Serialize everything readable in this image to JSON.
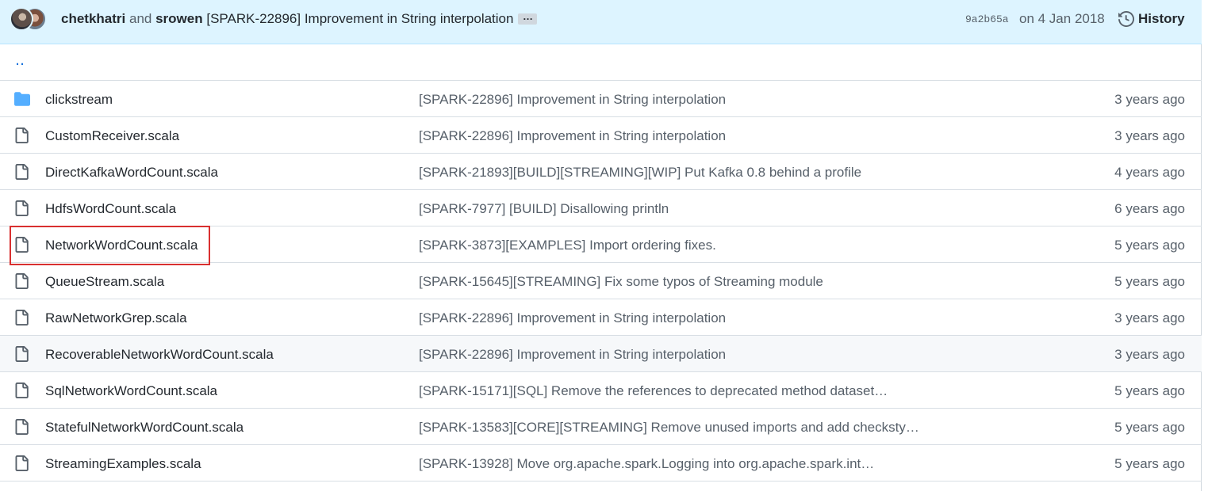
{
  "commit": {
    "authors": [
      "chetkhatri",
      "srowen"
    ],
    "joiner": "and",
    "message": "[SPARK-22896] Improvement in String interpolation",
    "more_label": "…",
    "sha": "9a2b65a",
    "date": "on 4 Jan 2018",
    "history_label": "History"
  },
  "parent_link": "‥",
  "files": [
    {
      "type": "folder",
      "name": "clickstream",
      "message": "[SPARK-22896] Improvement in String interpolation",
      "age": "3 years ago"
    },
    {
      "type": "file",
      "name": "CustomReceiver.scala",
      "message": "[SPARK-22896] Improvement in String interpolation",
      "age": "3 years ago"
    },
    {
      "type": "file",
      "name": "DirectKafkaWordCount.scala",
      "message": "[SPARK-21893][BUILD][STREAMING][WIP] Put Kafka 0.8 behind a profile",
      "age": "4 years ago"
    },
    {
      "type": "file",
      "name": "HdfsWordCount.scala",
      "message": "[SPARK-7977] [BUILD] Disallowing println",
      "age": "6 years ago"
    },
    {
      "type": "file",
      "name": "NetworkWordCount.scala",
      "message": "[SPARK-3873][EXAMPLES] Import ordering fixes.",
      "age": "5 years ago"
    },
    {
      "type": "file",
      "name": "QueueStream.scala",
      "message": "[SPARK-15645][STREAMING] Fix some typos of Streaming module",
      "age": "5 years ago"
    },
    {
      "type": "file",
      "name": "RawNetworkGrep.scala",
      "message": "[SPARK-22896] Improvement in String interpolation",
      "age": "3 years ago"
    },
    {
      "type": "file",
      "name": "RecoverableNetworkWordCount.scala",
      "message": "[SPARK-22896] Improvement in String interpolation",
      "age": "3 years ago"
    },
    {
      "type": "file",
      "name": "SqlNetworkWordCount.scala",
      "message": "[SPARK-15171][SQL] Remove the references to deprecated method dataset…",
      "age": "5 years ago"
    },
    {
      "type": "file",
      "name": "StatefulNetworkWordCount.scala",
      "message": "[SPARK-13583][CORE][STREAMING] Remove unused imports and add checksty…",
      "age": "5 years ago"
    },
    {
      "type": "file",
      "name": "StreamingExamples.scala",
      "message": "[SPARK-13928] Move org.apache.spark.Logging into org.apache.spark.int…",
      "age": "5 years ago"
    }
  ],
  "colors": {
    "header_bg": "#ddf4ff",
    "folder_icon": "#54aeff",
    "link": "#0969da",
    "highlight": "#d93030"
  }
}
